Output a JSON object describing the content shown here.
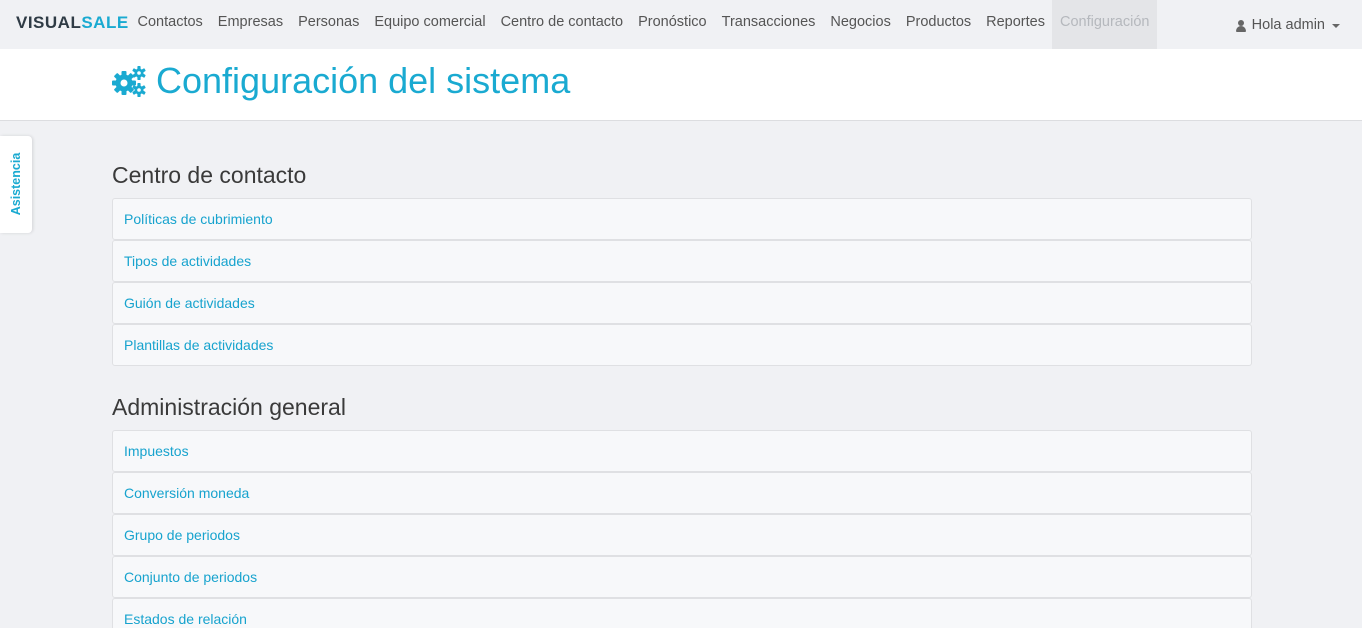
{
  "brand": {
    "part1": "VISUAL",
    "part2": "SALE"
  },
  "nav": {
    "items": [
      {
        "label": "Contactos"
      },
      {
        "label": "Empresas"
      },
      {
        "label": "Personas"
      },
      {
        "label": "Equipo comercial"
      },
      {
        "label": "Centro de contacto"
      },
      {
        "label": "Pronóstico"
      },
      {
        "label": "Transacciones"
      },
      {
        "label": "Negocios"
      },
      {
        "label": "Productos"
      },
      {
        "label": "Reportes"
      },
      {
        "label": "Configuración",
        "active": true
      }
    ],
    "user_label": "Hola admin"
  },
  "page": {
    "title": "Configuración del sistema",
    "icon": "gears-icon"
  },
  "side_tab": {
    "label": "Asistencia"
  },
  "sections": [
    {
      "title": "Centro de contacto",
      "items": [
        {
          "label": "Políticas de cubrimiento"
        },
        {
          "label": "Tipos de actividades"
        },
        {
          "label": "Guión de actividades"
        },
        {
          "label": "Plantillas de actividades"
        }
      ]
    },
    {
      "title": "Administración general",
      "items": [
        {
          "label": "Impuestos"
        },
        {
          "label": "Conversión moneda"
        },
        {
          "label": "Grupo de periodos"
        },
        {
          "label": "Conjunto de periodos"
        },
        {
          "label": "Estados de relación"
        }
      ]
    }
  ],
  "colors": {
    "accent": "#1aaad1",
    "brand_dark": "#2f3b45",
    "background": "#f0f1f4"
  }
}
